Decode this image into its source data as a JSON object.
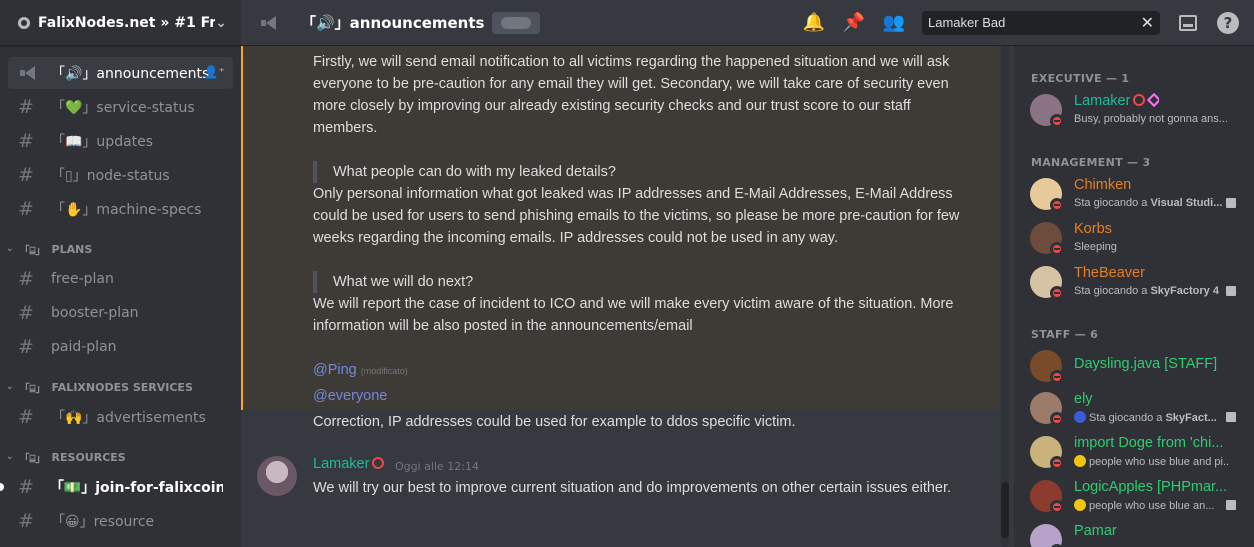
{
  "guild": {
    "name": "FalixNodes.net » #1 Fr..."
  },
  "sidebar": {
    "top_channels": [
      {
        "label": "「🔊」announcements",
        "icon": "megaphone-icon",
        "active": true
      },
      {
        "label": "「💚」service-status",
        "icon": "hash-icon"
      },
      {
        "label": "「📖」updates",
        "icon": "hash-icon"
      },
      {
        "label": "「▯」node-status",
        "icon": "hash-icon"
      },
      {
        "label": "「✋」machine-specs",
        "icon": "hash-icon"
      }
    ],
    "categories": [
      {
        "name": "PLANS",
        "channels": [
          "free-plan",
          "booster-plan",
          "paid-plan"
        ]
      },
      {
        "name": "FALIXNODES SERVICES",
        "channels": [
          "「🙌」advertisements"
        ]
      },
      {
        "name": "RESOURCES",
        "channels": [
          "「💵」join-for-falixcoins",
          "「😀」resource"
        ]
      }
    ],
    "cat_icon": "「⌸」"
  },
  "header": {
    "channel": "「🔊」announcements",
    "search_value": "Lamaker Bad",
    "icons": [
      "bell-icon",
      "pin-icon",
      "members-icon",
      "inbox-icon",
      "help-icon"
    ]
  },
  "messages": {
    "para1": "Firstly, we will send email notification to all victims regarding the happened situation and we will ask everyone to be pre-caution for any email they will get. Secondary, we will take care of security even more closely by improving our already existing security checks and our trust score to our staff members.",
    "quote1": "What people can do with my leaked details?",
    "para2": "Only personal information what got leaked was IP addresses and E-Mail Addresses, E-Mail Address could be used for users to send phishing emails to the victims, so please be more pre-caution for few weeks regarding the incoming emails. IP addresses could not be used in any way.",
    "quote2": "What we will do next?",
    "para3": "We will report the case of incident to ICO and we will make every victim aware of the situation. More information will be also posted in the announcements/email",
    "mention_ping": "@Ping",
    "edited": "(modificato)",
    "mention_everyone": "@everyone",
    "correction": "Correction, IP addresses could be used for example to ddos specific victim.",
    "last": {
      "author": "Lamaker",
      "timestamp": "Oggi alle 12:14",
      "text": "We will try our best to improve current situation and do improvements on other certain issues either."
    }
  },
  "members": {
    "groups": [
      {
        "title": "EXECUTIVE — 1"
      },
      {
        "title": "MANAGEMENT — 3"
      },
      {
        "title": "STAFF — 6"
      }
    ],
    "list": [
      {
        "name": "Lamaker",
        "color": "#1abc9c",
        "activity": "Busy, probably not gonna ans...",
        "activity_bold": "",
        "avatar": "#8a7384"
      },
      {
        "name": "Chimken",
        "color": "#e67e22",
        "activity": "Sta giocando a ",
        "activity_bold": "Visual Studi...",
        "avatar": "#e8c99a"
      },
      {
        "name": "Korbs",
        "color": "#e67e22",
        "activity": "Sleeping",
        "activity_bold": "",
        "avatar": "#6d4c3d"
      },
      {
        "name": "TheBeaver",
        "color": "#e67e22",
        "activity": "Sta giocando a ",
        "activity_bold": "SkyFactory 4",
        "avatar": "#d6c3a5"
      },
      {
        "name": "Daysling.java [STAFF]",
        "color": "#2ecc71",
        "activity": "",
        "activity_bold": "",
        "avatar": "#7a4b2a"
      },
      {
        "name": "ely",
        "color": "#2ecc71",
        "activity": "Sta giocando a ",
        "activity_bold": "SkyFact...",
        "avatar": "#9c7b6b"
      },
      {
        "name": "import Doge from 'chi...",
        "color": "#2ecc71",
        "activity": "people who use blue and pi...",
        "activity_bold": "",
        "avatar": "#c9b27c"
      },
      {
        "name": "LogicApples [PHPmar...",
        "color": "#2ecc71",
        "activity": "people who use blue an...",
        "activity_bold": "",
        "avatar": "#8b3a2e"
      },
      {
        "name": "Pamar",
        "color": "#2ecc71",
        "activity": "",
        "activity_bold": "",
        "avatar": "#b7a3c9"
      }
    ]
  }
}
